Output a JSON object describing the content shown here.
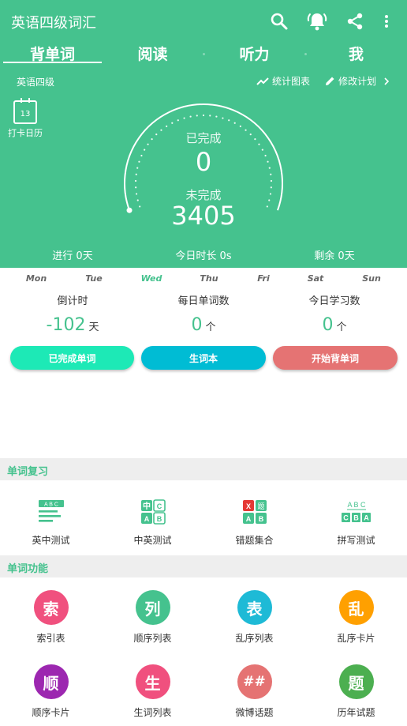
{
  "app": {
    "title": "英语四级词汇"
  },
  "tabs": [
    {
      "label": "背单词",
      "active": true
    },
    {
      "label": "阅读"
    },
    {
      "label": "听力"
    },
    {
      "label": "我"
    }
  ],
  "subheader": {
    "level": "英语四级",
    "chart_link": "统计图表",
    "plan_link": "修改计划"
  },
  "calendar": {
    "day": "13",
    "label": "打卡日历"
  },
  "gauge": {
    "done_label": "已完成",
    "done_value": "0",
    "todo_label": "未完成",
    "todo_value": "3405"
  },
  "stats": {
    "progress": "进行 0天",
    "today": "今日时长 0s",
    "remaining": "剩余 0天"
  },
  "week": {
    "days": [
      "Mon",
      "Tue",
      "Wed",
      "Thu",
      "Fri",
      "Sat",
      "Sun"
    ],
    "active_index": 2
  },
  "metrics": [
    {
      "label": "倒计时",
      "value": "-102",
      "unit": "天"
    },
    {
      "label": "每日单词数",
      "value": "0",
      "unit": "个"
    },
    {
      "label": "今日学习数",
      "value": "0",
      "unit": "个"
    }
  ],
  "actions": [
    {
      "label": "已完成单词",
      "color": "#1de9b6"
    },
    {
      "label": "生词本",
      "color": "#00bcd4"
    },
    {
      "label": "开始背单词",
      "color": "#e57373"
    }
  ],
  "review": {
    "title": "单词复习",
    "items": [
      {
        "label": "英中测试",
        "tile_text": "A B C"
      },
      {
        "label": "中英测试",
        "tile_chars": [
          "中",
          "C",
          "A",
          "B"
        ]
      },
      {
        "label": "错题集合",
        "tile_chars": [
          "X",
          "题",
          "A",
          "B"
        ]
      },
      {
        "label": "拼写测试",
        "tile_text": "A B C",
        "tile_chars": [
          "C",
          "B",
          "A"
        ]
      }
    ]
  },
  "functions": {
    "title": "单词功能",
    "items": [
      {
        "label": "索引表",
        "char": "索",
        "color": "#f0507e"
      },
      {
        "label": "顺序列表",
        "char": "列",
        "color": "#45c28e"
      },
      {
        "label": "乱序列表",
        "char": "表",
        "color": "#1ebad6"
      },
      {
        "label": "乱序卡片",
        "char": "乱",
        "color": "#ffa000"
      },
      {
        "label": "顺序卡片",
        "char": "顺",
        "color": "#9c27b0"
      },
      {
        "label": "生词列表",
        "char": "生",
        "color": "#f0507e"
      },
      {
        "label": "微博话题",
        "char": "##",
        "color": "#e57373"
      },
      {
        "label": "历年试题",
        "char": "题",
        "color": "#4caf50"
      }
    ]
  },
  "colors": {
    "brand": "#45c28e",
    "section_bg": "#eeeeee"
  }
}
